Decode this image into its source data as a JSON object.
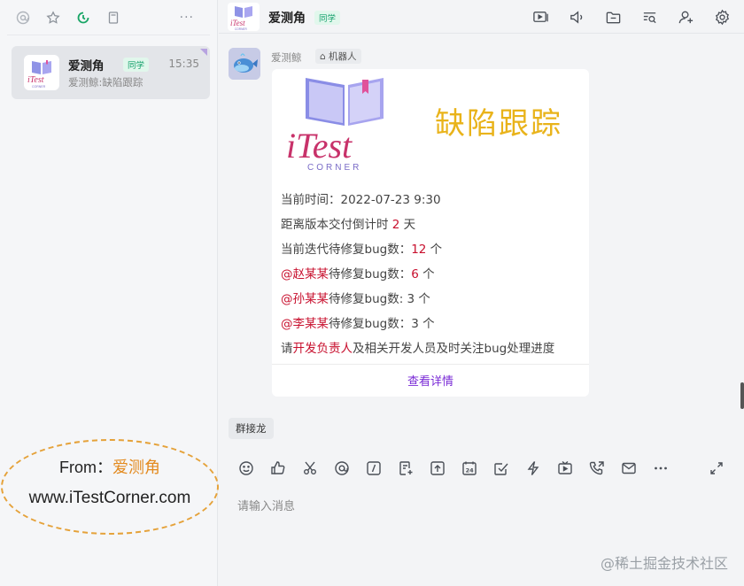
{
  "sidebar": {
    "top_icons": [
      "at-icon",
      "star-icon",
      "clock-icon",
      "bookmark-icon"
    ],
    "more_label": "···",
    "chat": {
      "name": "爱测角",
      "badge": "同学",
      "time": "15:35",
      "preview": "爱测鲸:缺陷跟踪"
    },
    "watermark": {
      "from_label": "From：",
      "from_name": "爱测角",
      "url": "www.iTestCorner.com"
    }
  },
  "header": {
    "title": "爱测角",
    "badge": "同学",
    "icons": [
      "screen-share-icon",
      "announcement-icon",
      "folder-icon",
      "search-history-icon",
      "add-member-icon",
      "settings-icon"
    ]
  },
  "message": {
    "sender": "爱测鲸",
    "bot_tag": "机器人",
    "card": {
      "logo_text": "iTest",
      "logo_sub": "CORNER",
      "banner_title": "缺陷跟踪",
      "lines": {
        "time_prefix": "当前时间：",
        "time_value": "2022-07-23 9:30",
        "countdown_prefix": "距离版本交付倒计时 ",
        "countdown_value": "2",
        "countdown_suffix": " 天",
        "iter_prefix": "当前迭代待修复bug数：",
        "iter_value": "12",
        "iter_suffix": " 个",
        "p1_name": "@赵某某",
        "p1_text": "待修复bug数：",
        "p1_value": "6",
        "p1_suffix": " 个",
        "p2_name": "@孙某某",
        "p2_text": "待修复bug数: 3 个",
        "p3_name": "@李某某",
        "p3_text": "待修复bug数：3 个",
        "req_prefix": "请",
        "req_highlight": "开发负责人",
        "req_suffix": "及相关开发人员及时关注bug处理进度"
      },
      "link": "查看详情"
    }
  },
  "solitaire_label": "群接龙",
  "toolbar_icons": [
    "emoji-icon",
    "thumbs-up-icon",
    "scissors-icon",
    "at-icon",
    "slash-command-icon",
    "doc-add-icon",
    "upload-icon",
    "calendar-24-icon",
    "checkbox-icon",
    "lightning-icon",
    "video-icon",
    "phone-icon",
    "mail-icon",
    "more-icon"
  ],
  "input": {
    "placeholder": "请输入消息"
  },
  "site_watermark": "@稀土掘金技术社区"
}
